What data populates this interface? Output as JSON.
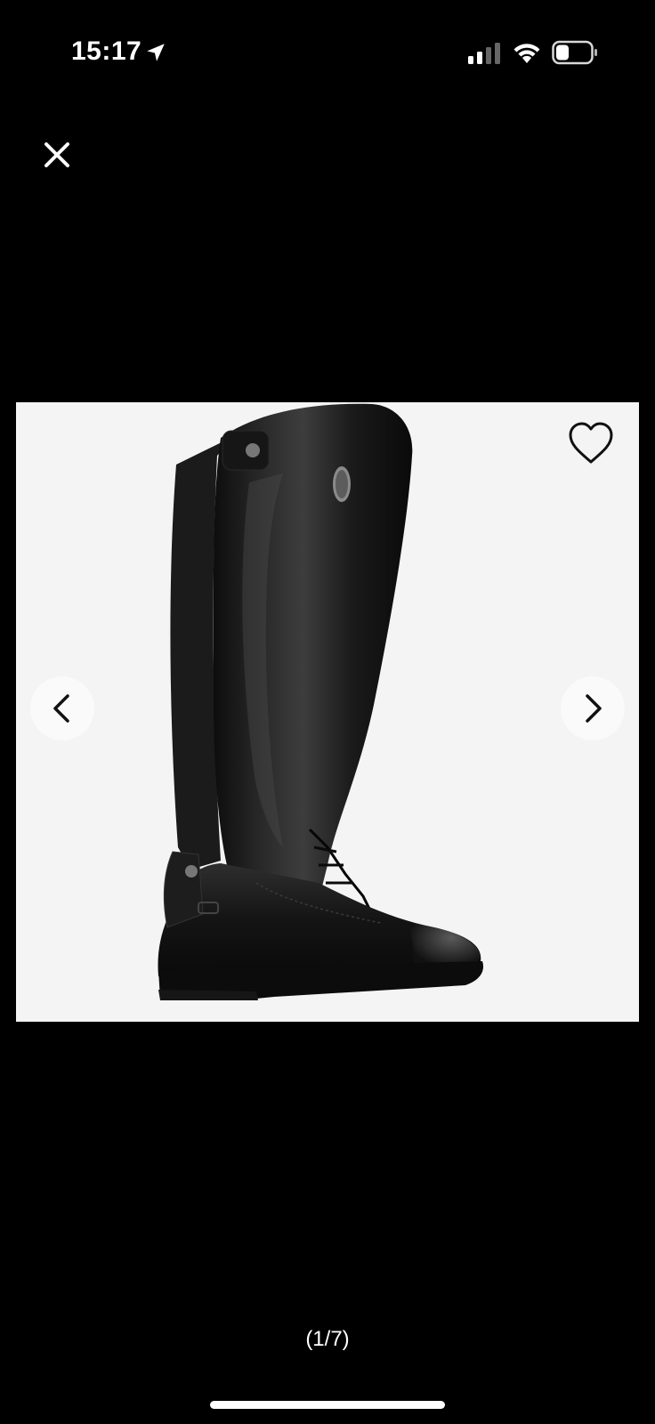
{
  "status_bar": {
    "time": "15:17",
    "location_icon": "location-arrow-icon",
    "signal_icon": "cellular-signal-icon",
    "wifi_icon": "wifi-icon",
    "battery_icon": "battery-icon"
  },
  "viewer": {
    "close_icon": "close-icon",
    "favorite_icon": "heart-outline-icon",
    "prev_icon": "chevron-left-icon",
    "next_icon": "chevron-right-icon",
    "product_image": "black-leather-riding-boot",
    "counter": "(1/7)",
    "background_color": "#f4f4f4"
  },
  "colors": {
    "screen_background": "#000000",
    "foreground": "#ffffff"
  }
}
